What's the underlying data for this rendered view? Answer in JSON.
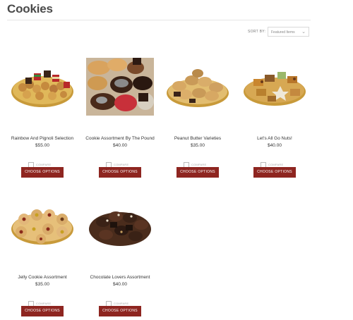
{
  "page": {
    "title": "Cookies"
  },
  "sort": {
    "label": "SORT BY:",
    "selected": "Featured Items"
  },
  "products": [
    {
      "name": "Rainbow And Pignoli Selection",
      "price": "$55.00",
      "compare_label": "COMPARE",
      "button_label": "CHOOSE OPTIONS"
    },
    {
      "name": "Cookie Assortment By The Pound",
      "price": "$40.00",
      "compare_label": "COMPARE",
      "button_label": "CHOOSE OPTIONS"
    },
    {
      "name": "Peanut Butter Varieties",
      "price": "$35.00",
      "compare_label": "COMPARE",
      "button_label": "CHOOSE OPTIONS"
    },
    {
      "name": "Let's All Go Nuts!",
      "price": "$40.00",
      "compare_label": "COMPARE",
      "button_label": "CHOOSE OPTIONS"
    },
    {
      "name": "Jelly Cookie Assortment",
      "price": "$35.00",
      "compare_label": "COMPARE",
      "button_label": "CHOOSE OPTIONS"
    },
    {
      "name": "Chocolate Lovers Assortment",
      "price": "$40.00",
      "compare_label": "COMPARE",
      "button_label": "CHOOSE OPTIONS"
    }
  ],
  "colors": {
    "button": "#8e2520",
    "title": "#4a4a4a"
  }
}
